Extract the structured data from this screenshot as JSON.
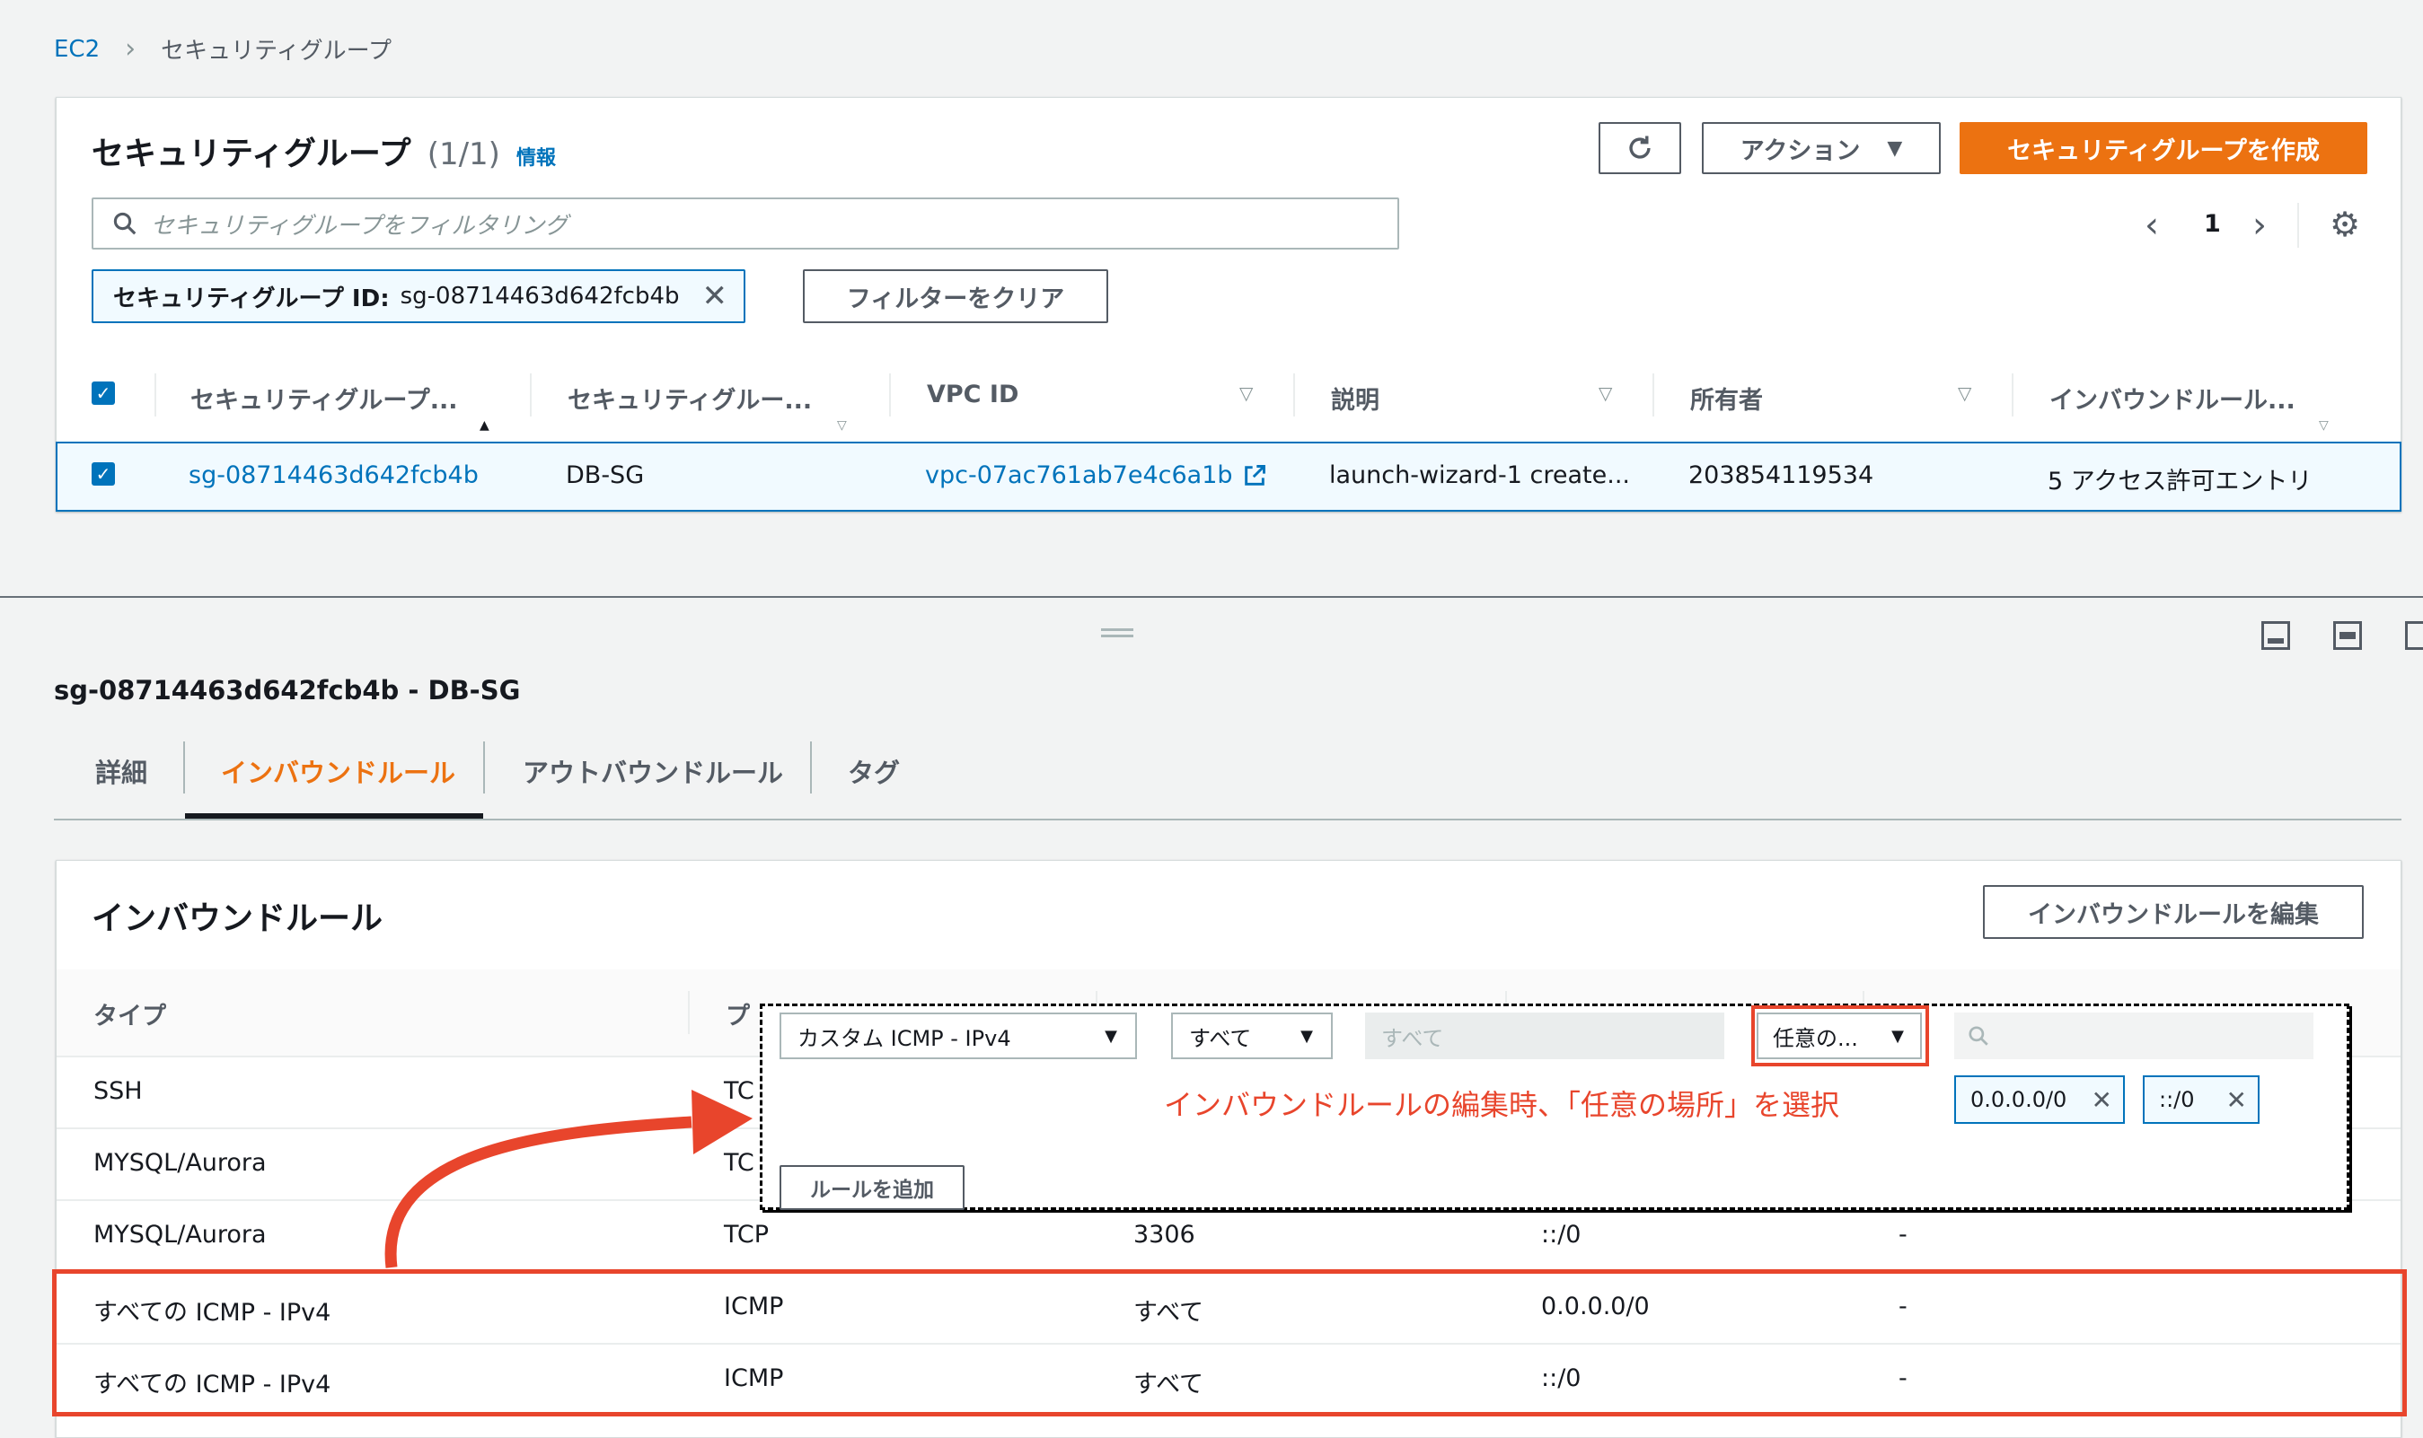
{
  "breadcrumb": {
    "root": "EC2",
    "current": "セキュリティグループ"
  },
  "header": {
    "title": "セキュリティグループ",
    "count": "(1/1)",
    "info": "情報",
    "actions_label": "アクション",
    "create_label": "セキュリティグループを作成"
  },
  "search": {
    "placeholder": "セキュリティグループをフィルタリング"
  },
  "filter": {
    "token_label": "セキュリティグループ ID:",
    "token_value": "sg-08714463d642fcb4b",
    "clear_label": "フィルターをクリア"
  },
  "pagination": {
    "page": "1"
  },
  "table": {
    "columns": [
      "セキュリティグループ...",
      "セキュリティグルー...",
      "VPC ID",
      "説明",
      "所有者",
      "インバウンドルール..."
    ],
    "row": {
      "sg_id": "sg-08714463d642fcb4b",
      "name": "DB-SG",
      "vpc": "vpc-07ac761ab7e4c6a1b",
      "desc": "launch-wizard-1 create...",
      "owner": "203854119534",
      "inbound": "5 アクセス許可エントリ"
    }
  },
  "detail": {
    "title": "sg-08714463d642fcb4b - DB-SG",
    "tabs": [
      "詳細",
      "インバウンドルール",
      "アウトバウンドルール",
      "タグ"
    ],
    "rules_title": "インバウンドルール",
    "edit_label": "インバウンドルールを編集",
    "col_type": "タイプ",
    "col_proto_partial": "プ",
    "rules": [
      {
        "type": "SSH",
        "proto": "TC",
        "port": "",
        "source": "",
        "desc": ""
      },
      {
        "type": "MYSQL/Aurora",
        "proto": "TC",
        "port": "",
        "source": "",
        "desc": ""
      },
      {
        "type": "MYSQL/Aurora",
        "proto": "TCP",
        "port": "3306",
        "source": "::/0",
        "desc": "-"
      },
      {
        "type": "すべての ICMP - IPv4",
        "proto": "ICMP",
        "port": "すべて",
        "source": "0.0.0.0/0",
        "desc": "-"
      },
      {
        "type": "すべての ICMP - IPv4",
        "proto": "ICMP",
        "port": "すべて",
        "source": "::/0",
        "desc": "-"
      }
    ]
  },
  "overlay": {
    "type_select": "カスタム ICMP - IPv4",
    "proto_select": "すべて",
    "port_input": "すべて",
    "source_select": "任意の...",
    "token1": "0.0.0.0/0",
    "token2": "::/0",
    "add_rule": "ルールを追加",
    "annotation": "インバウンドルールの編集時、「任意の場所」を選択"
  },
  "colors": {
    "accent": "#ec7211",
    "link": "#0073bb",
    "highlight": "#e8452c"
  }
}
